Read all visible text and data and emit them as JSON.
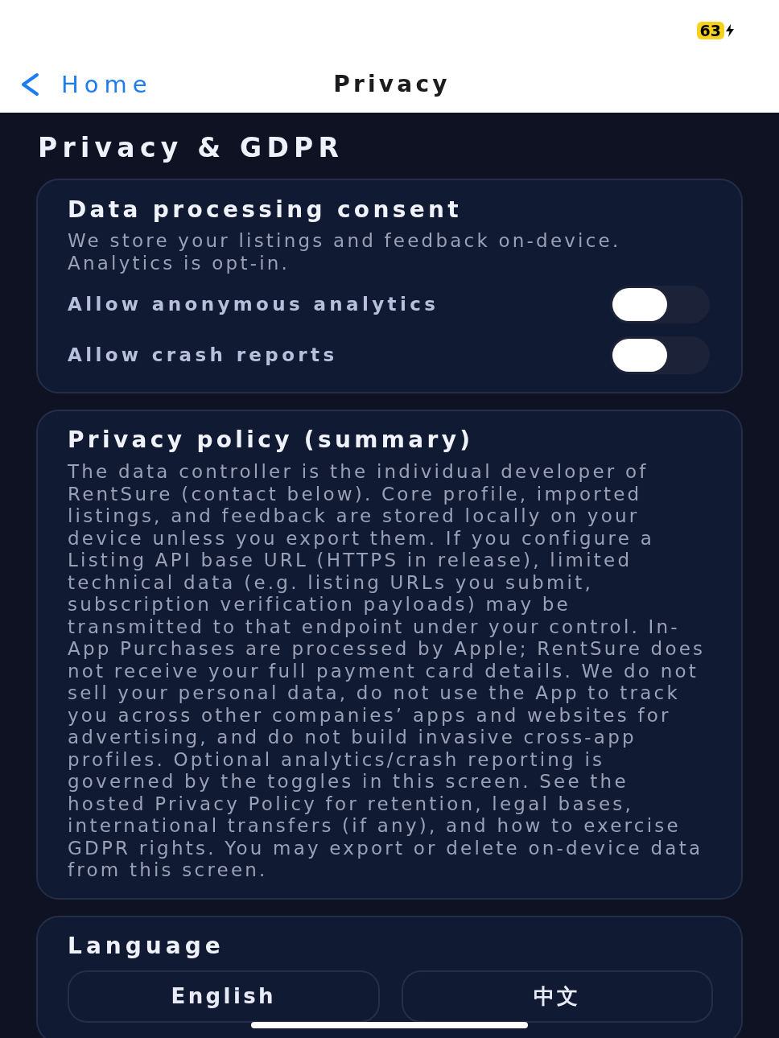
{
  "status_bar": {
    "battery": "63"
  },
  "nav": {
    "back": "Home",
    "title": "Privacy"
  },
  "page_title": "Privacy & GDPR",
  "consent": {
    "title": "Data processing consent",
    "description": "We store your listings and feedback on-device. Analytics is opt-in.",
    "toggles": [
      {
        "label": "Allow anonymous analytics",
        "on": false
      },
      {
        "label": "Allow crash reports",
        "on": false
      }
    ]
  },
  "policy": {
    "title": "Privacy policy (summary)",
    "text": "The data controller is the individual developer of RentSure (contact below). Core profile, imported listings, and feedback are stored locally on your device unless you export them. If you configure a Listing API base URL (HTTPS in release), limited technical data (e.g. listing URLs you submit, subscription verification payloads) may be transmitted to that endpoint under your control. In-App Purchases are processed by Apple; RentSure does not receive your full payment card details. We do not sell your personal data, do not use the App to track you across other companies’ apps and websites for advertising, and do not build invasive cross-app profiles. Optional analytics/crash reporting is governed by the toggles in this screen. See the hosted Privacy Policy for retention, legal bases, international transfers (if any), and how to exercise GDPR rights. You may export or delete on-device data from this screen."
  },
  "language": {
    "title": "Language",
    "options": [
      {
        "label": "English",
        "selected": false
      },
      {
        "label": "中文",
        "selected": false
      }
    ]
  }
}
